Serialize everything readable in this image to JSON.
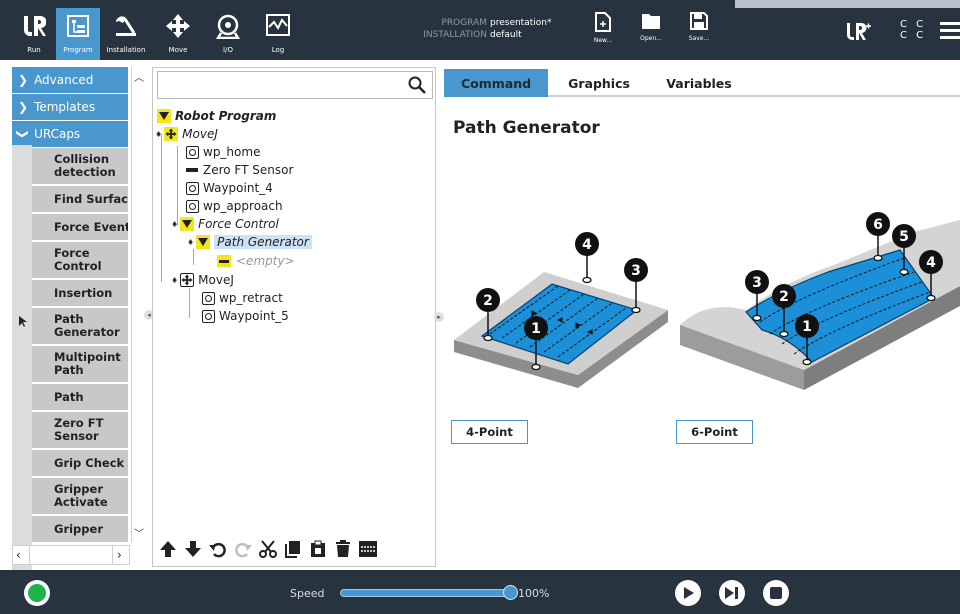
{
  "header": {
    "nav": [
      {
        "label": "Run",
        "icon": "ur-logo-icon"
      },
      {
        "label": "Program",
        "icon": "program-icon",
        "active": true
      },
      {
        "label": "Installation",
        "icon": "installation-icon"
      },
      {
        "label": "Move",
        "icon": "move-icon"
      },
      {
        "label": "I/O",
        "icon": "io-icon"
      },
      {
        "label": "Log",
        "icon": "log-icon"
      }
    ],
    "program_key": "PROGRAM",
    "program_value": "presentation*",
    "installation_key": "INSTALLATION",
    "installation_value": "default",
    "file_buttons": [
      {
        "label": "New...",
        "icon": "new-file-icon"
      },
      {
        "label": "Open...",
        "icon": "folder-icon"
      },
      {
        "label": "Save...",
        "icon": "save-icon"
      }
    ],
    "cc_top": "C C",
    "cc_bottom": "C C"
  },
  "leftnav": {
    "categories": [
      {
        "label": "Advanced",
        "chevron": ">"
      },
      {
        "label": "Templates",
        "chevron": ">"
      },
      {
        "label": "URCaps",
        "chevron": "v"
      }
    ],
    "urcaps": [
      "Collision detection",
      "Find Surface",
      "Force Event",
      "Force Control",
      "Insertion",
      "Path Generator",
      "Multipoint Path",
      "Path",
      "Zero FT Sensor",
      "Grip Check",
      "Gripper Activate",
      "Gripper"
    ]
  },
  "tree": {
    "search_value": "",
    "robot_program": "Robot Program",
    "movej1": "MoveJ",
    "wp_home": "wp_home",
    "zero_ft": "Zero FT Sensor",
    "waypoint4": "Waypoint_4",
    "wp_approach": "wp_approach",
    "force_control": "Force Control",
    "path_generator": "Path Generator",
    "empty": "<empty>",
    "movej2": "MoveJ",
    "wp_retract": "wp_retract",
    "waypoint5": "Waypoint_5"
  },
  "tabs": [
    "Command",
    "Graphics",
    "Variables"
  ],
  "panel": {
    "title": "Path Generator",
    "option_4": "4-Point",
    "option_6": "6-Point",
    "labels_4": [
      "1",
      "2",
      "3",
      "4"
    ],
    "labels_6": [
      "1",
      "2",
      "3",
      "4",
      "5",
      "6"
    ]
  },
  "footer": {
    "speed_label": "Speed",
    "speed_value": "100%",
    "speed_fraction": 1.0
  },
  "colors": {
    "header_bg": "#27343f",
    "accent_blue": "#4a97cd",
    "node_yellow": "#f2e51c",
    "power_green": "#1fb34a"
  }
}
